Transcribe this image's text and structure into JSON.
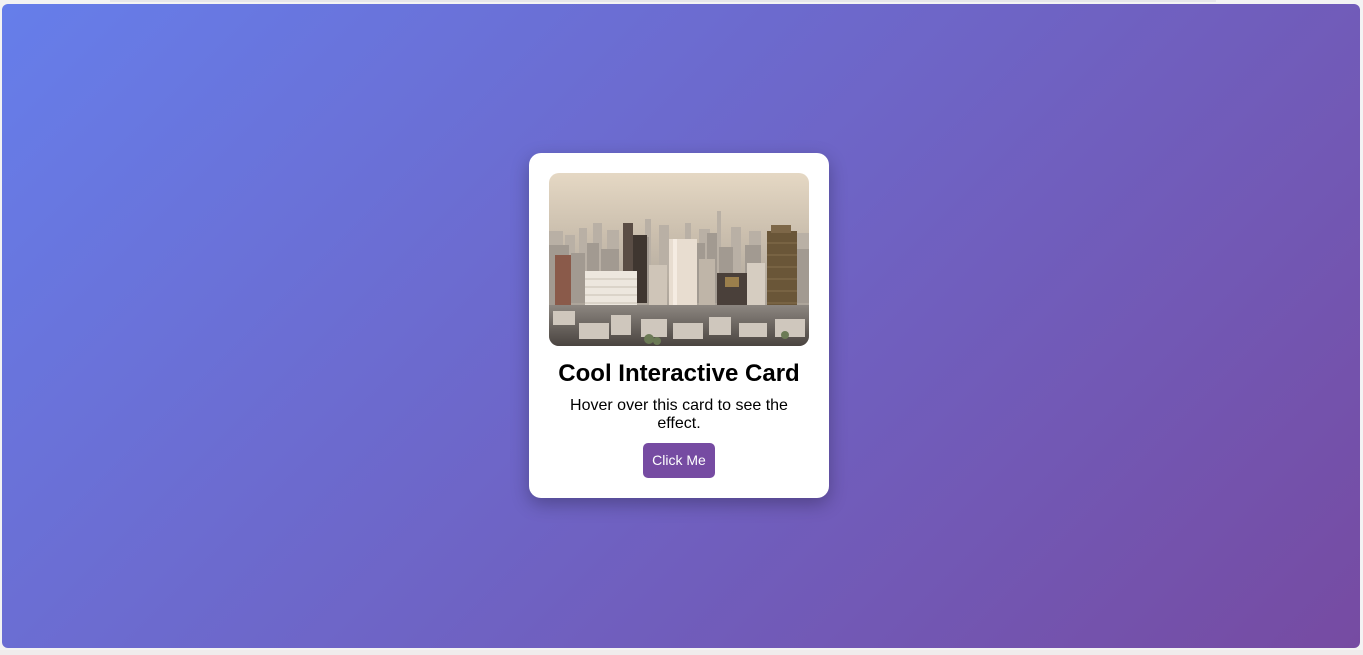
{
  "colors": {
    "gradient_start": "#667eea",
    "gradient_end": "#764ba2",
    "card_background": "#ffffff",
    "button_background": "#764ba2",
    "button_text": "#ffffff"
  },
  "card": {
    "image_subject": "city skyline photo",
    "title": "Cool Interactive Card",
    "description": "Hover over this card to see the effect.",
    "button_label": "Click Me"
  }
}
